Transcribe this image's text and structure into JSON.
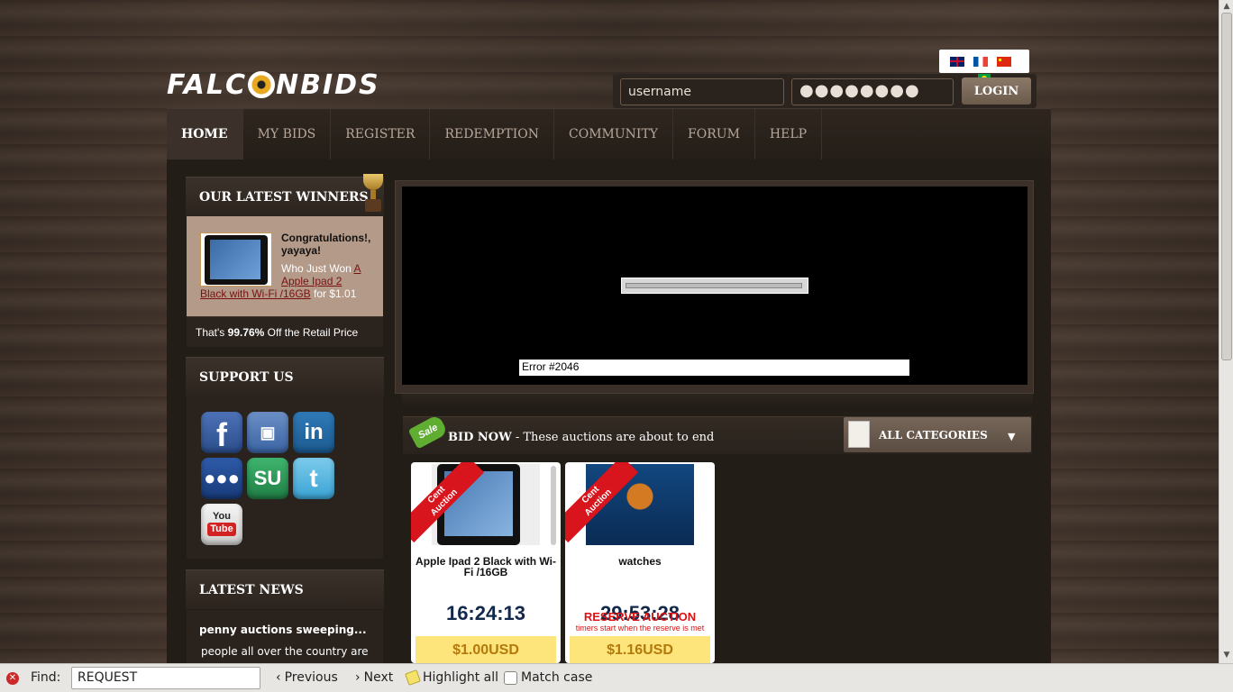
{
  "logo": {
    "before": "FALC",
    "after": "NBIDS"
  },
  "flags": [
    "uk-flag",
    "fr-flag",
    "cn-flag",
    "br-flag"
  ],
  "login": {
    "username": "username",
    "password": "●●●●●●●●",
    "button": "LOGIN"
  },
  "nav": [
    {
      "label": "HOME",
      "active": true
    },
    {
      "label": "MY BIDS"
    },
    {
      "label": "REGISTER"
    },
    {
      "label": "REDEMPTION"
    },
    {
      "label": "COMMUNITY"
    },
    {
      "label": "FORUM"
    },
    {
      "label": "HELP"
    }
  ],
  "winners": {
    "heading": "OUR LATEST WINNERS",
    "congrats": "Congratulations!, yayaya!",
    "who_won": "Who Just Won ",
    "item_link": "A Apple Ipad 2 Black with Wi-Fi /16GB",
    "item_link_line1": "A",
    "item_link_line2": "Apple Ipad 2",
    "item_link_line3": "Black with Wi-Fi /16GB",
    "for_price": " for $1.01",
    "retail_prefix": "That's ",
    "retail_percent": "99.76%",
    "retail_suffix": " Off the Retail Price"
  },
  "support": {
    "heading": "SUPPORT US",
    "icons": [
      "facebook-icon",
      "delicious-icon",
      "linkedin-icon",
      "myspace-icon",
      "stumbleupon-icon",
      "twitter-icon",
      "youtube-icon"
    ],
    "fb": "f",
    "li": "in",
    "su": "SU",
    "tw": "t",
    "yt_you": "You",
    "yt_tube": "Tube"
  },
  "news": {
    "heading": "LATEST NEWS",
    "title": "penny auctions sweeping...",
    "body": "people all over the country are"
  },
  "flash": {
    "error": "Error #2046"
  },
  "bidnow": {
    "bold": "BID NOW",
    "rest": " - These auctions are about to end",
    "sale_tag": "Sale",
    "category": "ALL CATEGORIES"
  },
  "auctions": [
    {
      "ribbon_line1": "Cent",
      "ribbon_line2": "Auction",
      "name": "Apple Ipad 2 Black with Wi-Fi /16GB",
      "timer": "16:24:13",
      "price": "$1.00",
      "currency": "USD"
    },
    {
      "ribbon_line1": "Cent",
      "ribbon_line2": "Auction",
      "name": "watches",
      "timer": "29:53:28",
      "reserve": "RESERVE AUCTION",
      "reserve_sub": "timers start when the reserve is met",
      "price": "$1.16",
      "currency": "USD"
    }
  ],
  "findbar": {
    "label": "Find:",
    "query": "REQUEST",
    "previous": "Previous",
    "next": "Next",
    "highlight": "Highlight all",
    "match_case": "Match case"
  }
}
